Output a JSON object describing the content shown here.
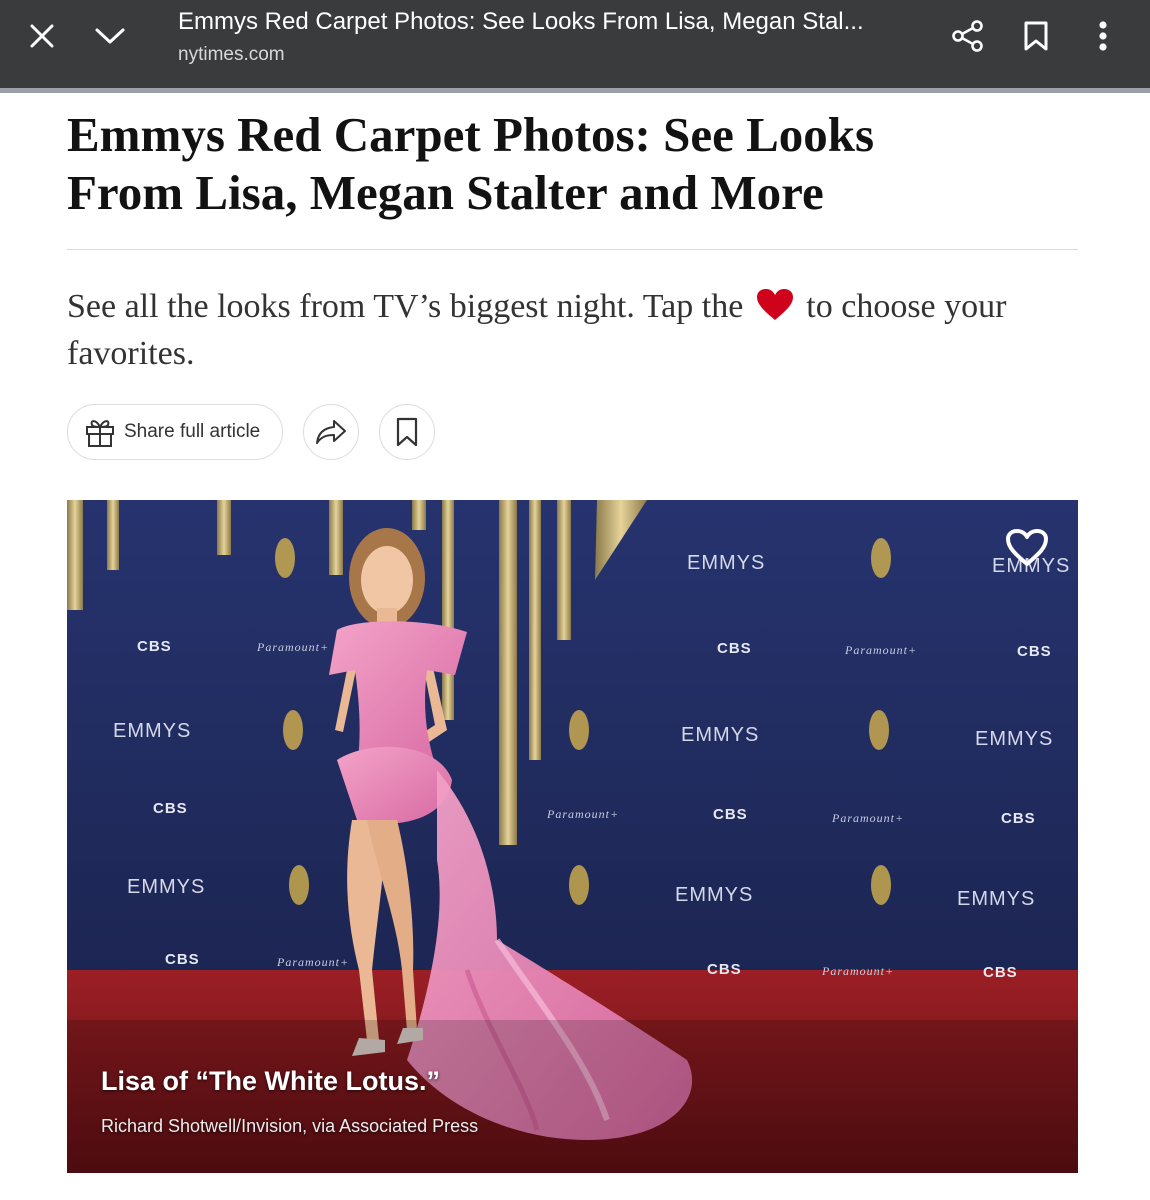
{
  "browser": {
    "page_title": "Emmys Red Carpet Photos: See Looks From Lisa, Megan Stal...",
    "url": "nytimes.com",
    "icons": [
      "close-icon",
      "chevron-down-icon",
      "share-icon",
      "bookmark-icon",
      "more-vert-icon"
    ]
  },
  "article": {
    "headline": "Emmys Red Carpet Photos: See Looks From Lisa, Megan Stalter and More",
    "summary_before": "See all the looks from TV’s biggest night. Tap the",
    "summary_after": "to choose your favorites.",
    "share_full_label": "Share full article",
    "accent_heart_color": "#d0021b"
  },
  "photo": {
    "caption": "Lisa of “The White Lotus.”",
    "credit": "Richard Shotwell/Invision, via Associated Press",
    "backdrop_text": {
      "emmys": "EMMYS",
      "cbs": "CBS",
      "paramount": "Paramount+"
    },
    "colors": {
      "backdrop": "#1f2a5c",
      "carpet": "#8c1a1f",
      "dress": "#e889b8"
    }
  }
}
